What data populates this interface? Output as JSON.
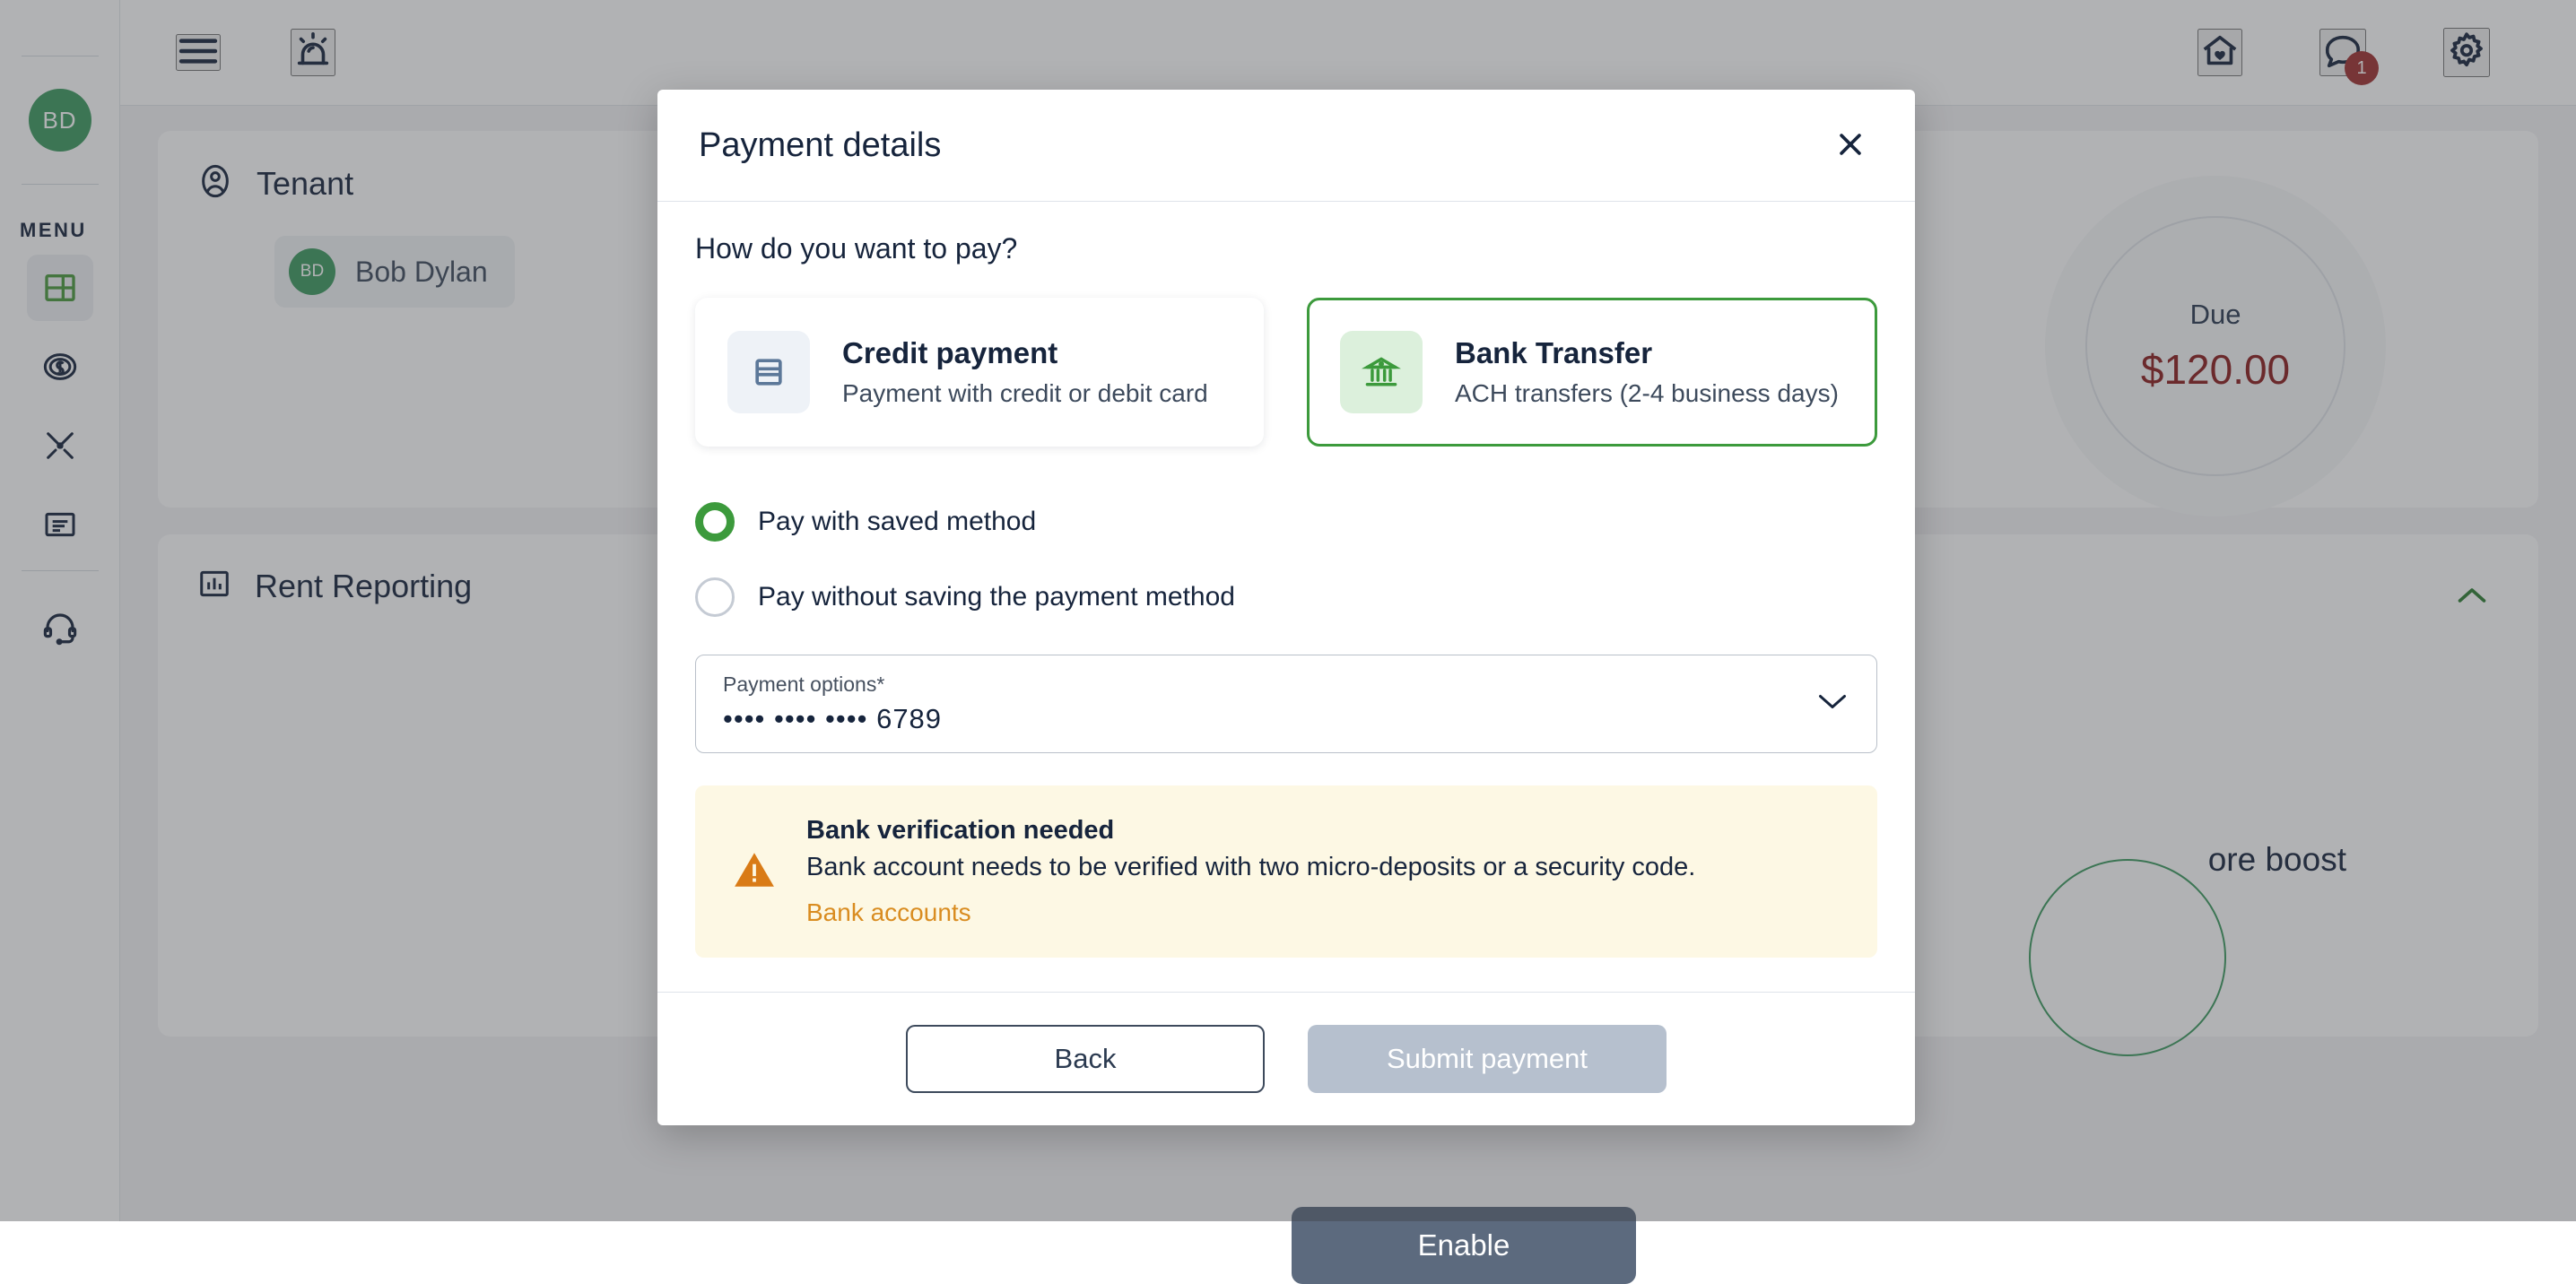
{
  "sidebar": {
    "avatar_initials": "BD",
    "menu_label": "MENU",
    "items": [
      {
        "name": "dashboard",
        "icon": "dashboard-icon",
        "active": true
      },
      {
        "name": "payments",
        "icon": "dollar-circle-icon",
        "active": false
      },
      {
        "name": "maintenance",
        "icon": "tools-icon",
        "active": false
      },
      {
        "name": "documents",
        "icon": "document-icon",
        "active": false
      },
      {
        "name": "support",
        "icon": "headset-icon",
        "active": false
      }
    ]
  },
  "topbar": {
    "menu_icon": "hamburger-icon",
    "alert_icon": "siren-icon",
    "home_icon": "home-heart-icon",
    "messages_icon": "chat-bubble-icon",
    "messages_badge": "1",
    "settings_icon": "gear-icon"
  },
  "background": {
    "tenant_card": {
      "icon": "user-circle-icon",
      "title": "Tenant",
      "chip_initials": "BD",
      "chip_name": "Bob Dylan"
    },
    "due": {
      "label": "Due",
      "amount": "$120.00"
    },
    "rent_reporting": {
      "icon": "chart-icon",
      "title": "Rent Reporting",
      "collapse_icon": "chevron-up-icon",
      "boost_text": "ore boost",
      "enable_label": "Enable"
    }
  },
  "modal": {
    "title": "Payment details",
    "close_icon": "close-icon",
    "question": "How do you want to pay?",
    "methods": [
      {
        "id": "credit",
        "icon": "credit-card-icon",
        "name": "Credit payment",
        "desc": "Payment with credit or debit card",
        "selected": false
      },
      {
        "id": "bank",
        "icon": "bank-icon",
        "name": "Bank Transfer",
        "desc": "ACH transfers (2-4 business days)",
        "selected": true
      }
    ],
    "save_options": [
      {
        "id": "saved",
        "label": "Pay with saved method",
        "checked": true
      },
      {
        "id": "unsaved",
        "label": "Pay without saving the payment method",
        "checked": false
      }
    ],
    "payment_select": {
      "caption": "Payment options*",
      "value": "•••• •••• •••• 6789",
      "chevron_icon": "chevron-down-icon"
    },
    "alert": {
      "icon": "warning-triangle-icon",
      "title": "Bank verification needed",
      "text": "Bank account needs to be verified with two micro-deposits or a security code.",
      "link": "Bank accounts"
    },
    "footer": {
      "back_label": "Back",
      "submit_label": "Submit payment"
    }
  },
  "colors": {
    "accent_green": "#3c9a3c",
    "avatar_green": "#3c9a5f",
    "ink": "#16243c",
    "alert_bg": "#fdf8e4",
    "alert_orange": "#d98c20",
    "due_red": "#8b1d1d",
    "badge_red": "#9e3030",
    "submit_disabled": "#b6c0ce"
  }
}
